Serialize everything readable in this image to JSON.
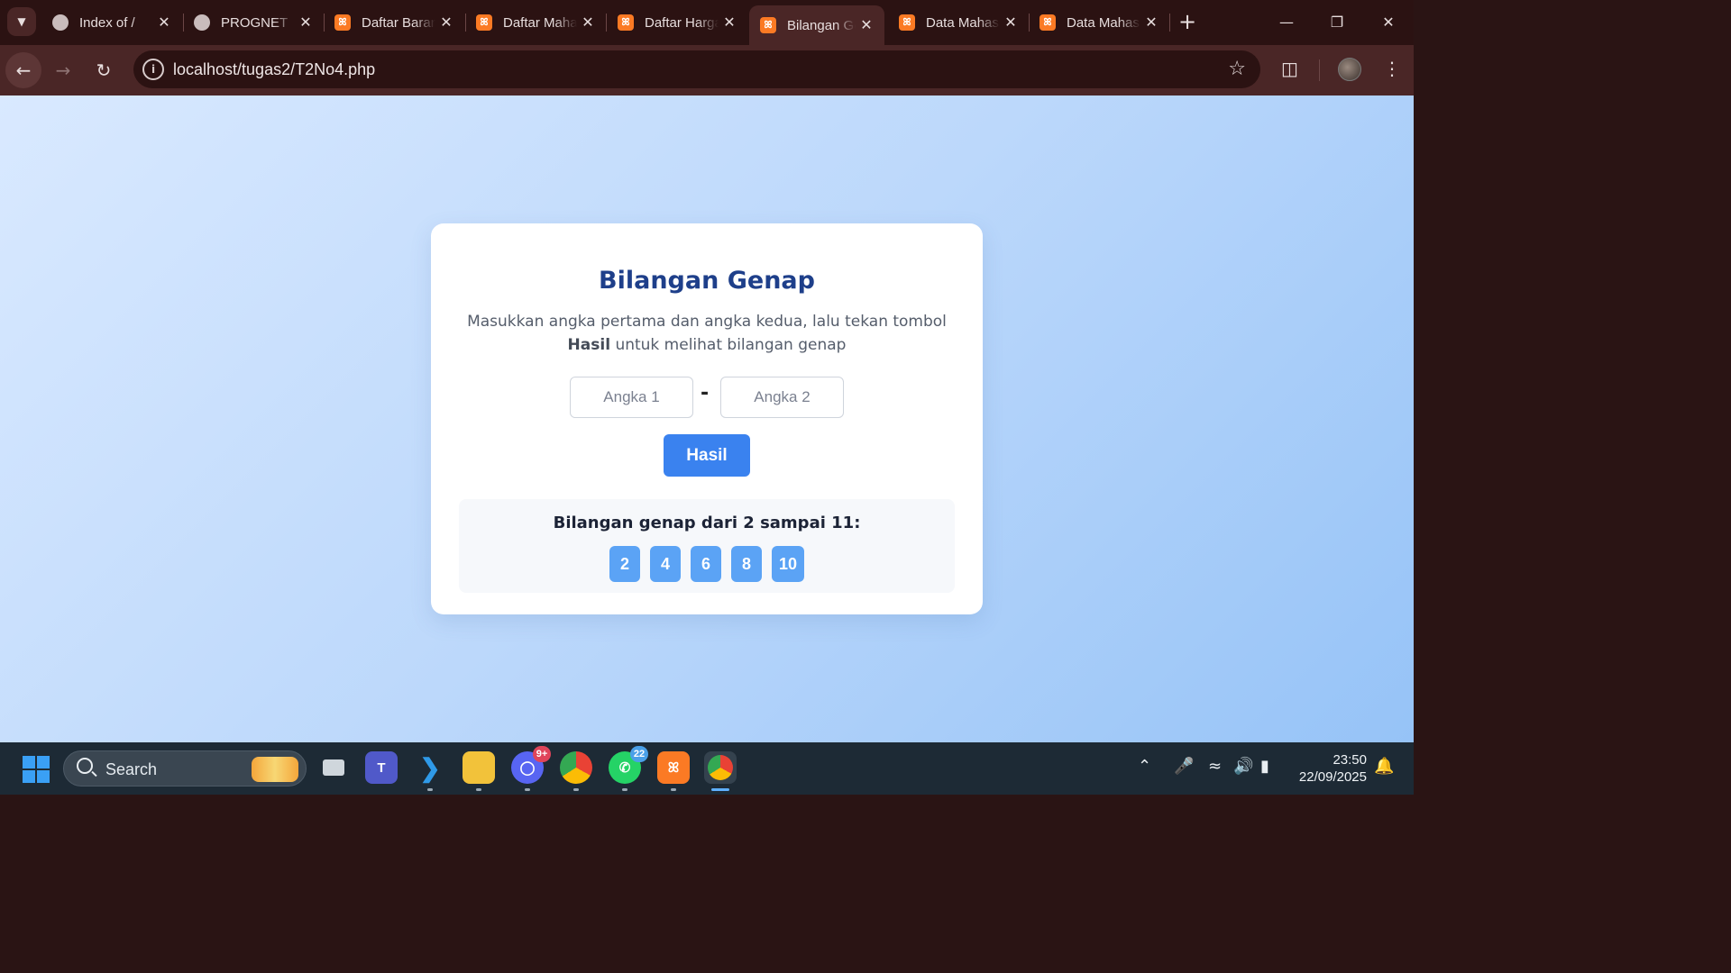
{
  "browser": {
    "tabs": [
      {
        "title": "Index of /",
        "favicon": "globe-icon",
        "active": false
      },
      {
        "title": "PROGNET",
        "favicon": "globe-icon",
        "active": false
      },
      {
        "title": "Daftar Barang",
        "favicon": "xampp-icon",
        "active": false
      },
      {
        "title": "Daftar Mahasiswa",
        "favicon": "xampp-icon",
        "active": false
      },
      {
        "title": "Daftar Harga",
        "favicon": "xampp-icon",
        "active": false
      },
      {
        "title": "Bilangan Genap",
        "favicon": "xampp-icon",
        "active": true
      },
      {
        "title": "Data Mahasiswa",
        "favicon": "xampp-icon",
        "active": false
      },
      {
        "title": "Data Mahasiswa",
        "favicon": "xampp-icon",
        "active": false
      }
    ],
    "url": "localhost/tugas2/T2No4.php"
  },
  "page": {
    "title": "Bilangan Genap",
    "description_part1": "Masukkan angka pertama dan angka kedua, lalu tekan tombol",
    "description_bold": "Hasil",
    "description_part2": "untuk melihat bilangan genap",
    "input1_placeholder": "Angka 1",
    "input2_placeholder": "Angka 2",
    "separator": "-",
    "button_label": "Hasil",
    "result_title": "Bilangan genap dari 2 sampai 11:",
    "results": [
      "2",
      "4",
      "6",
      "8",
      "10"
    ]
  },
  "taskbar": {
    "search_label": "Search",
    "discord_badge": "9+",
    "whatsapp_badge": "22",
    "time": "23:50",
    "date": "22/09/2025"
  },
  "colors": {
    "accent": "#3a82ef",
    "title": "#1e3f8a",
    "chip": "#5ba3f5",
    "browser_frame": "#4a2626"
  }
}
